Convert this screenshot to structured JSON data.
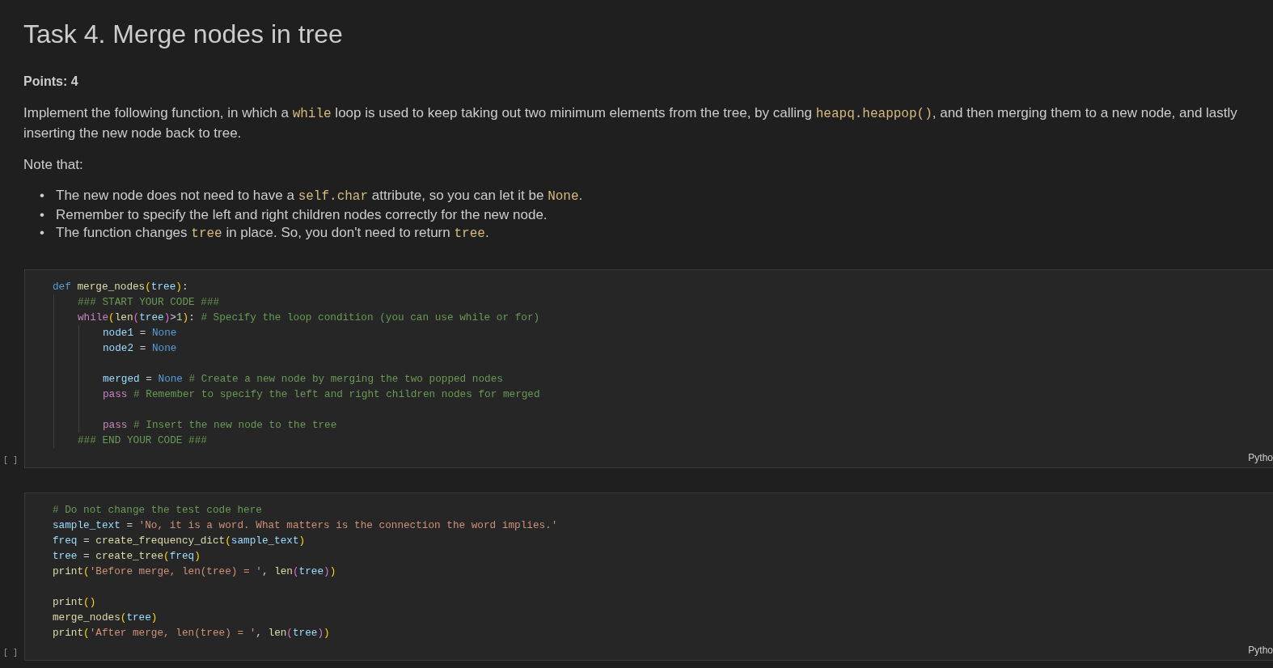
{
  "title": "Task 4. Merge nodes in tree",
  "points": "Points: 4",
  "intro": [
    {
      "kind": "text",
      "text": "Implement the following function, in which a "
    },
    {
      "kind": "code",
      "text": "while"
    },
    {
      "kind": "text",
      "text": " loop is used to keep taking out two minimum elements from the tree, by calling "
    },
    {
      "kind": "code",
      "text": "heapq.heappop()"
    },
    {
      "kind": "text",
      "text": ", and then merging them to a new node, and lastly inserting the new node back to tree."
    }
  ],
  "note": "Note that:",
  "bullets": [
    {
      "marker": "•",
      "segments": [
        {
          "kind": "text",
          "text": "The new node does not need to have a "
        },
        {
          "kind": "code",
          "text": "self.char"
        },
        {
          "kind": "text",
          "text": " attribute, so you can let it be "
        },
        {
          "kind": "code",
          "text": "None"
        },
        {
          "kind": "text",
          "text": "."
        }
      ]
    },
    {
      "marker": "•",
      "segments": [
        {
          "kind": "text",
          "text": "Remember to specify the left and right children nodes correctly for the new node."
        }
      ]
    },
    {
      "marker": "•",
      "segments": [
        {
          "kind": "text",
          "text": "The function changes "
        },
        {
          "kind": "code",
          "text": "tree"
        },
        {
          "kind": "text",
          "text": " in place. So, you don't need to return "
        },
        {
          "kind": "code",
          "text": "tree"
        },
        {
          "kind": "text",
          "text": "."
        }
      ]
    }
  ],
  "cells": [
    {
      "execution_count": "[ ]",
      "language": "Pytho",
      "lines": [
        {
          "kind": "code",
          "tokens": [
            {
              "kind": "kw",
              "text": "def "
            },
            {
              "kind": "fn",
              "text": "merge_nodes"
            },
            {
              "kind": "p1",
              "text": "("
            },
            {
              "kind": "var",
              "text": "tree"
            },
            {
              "kind": "p1",
              "text": ")"
            },
            {
              "kind": "op",
              "text": ":"
            }
          ],
          "children": [
            {
              "kind": "code",
              "tokens": [
                {
                  "kind": "comment",
                  "text": "### START YOUR CODE ###"
                }
              ]
            },
            {
              "kind": "code",
              "tokens": [
                {
                  "kind": "ctrl",
                  "text": "while"
                },
                {
                  "kind": "p1",
                  "text": "("
                },
                {
                  "kind": "fn",
                  "text": "len"
                },
                {
                  "kind": "p2",
                  "text": "("
                },
                {
                  "kind": "var",
                  "text": "tree"
                },
                {
                  "kind": "p2",
                  "text": ")"
                },
                {
                  "kind": "op",
                  "text": ">"
                },
                {
                  "kind": "num",
                  "text": "1"
                },
                {
                  "kind": "p1",
                  "text": ")"
                },
                {
                  "kind": "op",
                  "text": ": "
                },
                {
                  "kind": "comment",
                  "text": "# Specify the loop condition (you can use while or for)"
                }
              ],
              "children": [
                {
                  "kind": "code",
                  "tokens": [
                    {
                      "kind": "var",
                      "text": "node1"
                    },
                    {
                      "kind": "op",
                      "text": " = "
                    },
                    {
                      "kind": "kw",
                      "text": "None"
                    }
                  ]
                },
                {
                  "kind": "code",
                  "tokens": [
                    {
                      "kind": "var",
                      "text": "node2"
                    },
                    {
                      "kind": "op",
                      "text": " = "
                    },
                    {
                      "kind": "kw",
                      "text": "None"
                    }
                  ]
                },
                {
                  "kind": "blank"
                },
                {
                  "kind": "code",
                  "tokens": [
                    {
                      "kind": "var",
                      "text": "merged"
                    },
                    {
                      "kind": "op",
                      "text": " = "
                    },
                    {
                      "kind": "kw",
                      "text": "None"
                    },
                    {
                      "kind": "comment",
                      "text": " # Create a new node by merging the two popped nodes"
                    }
                  ]
                },
                {
                  "kind": "code",
                  "tokens": [
                    {
                      "kind": "ctrl",
                      "text": "pass"
                    },
                    {
                      "kind": "comment",
                      "text": " # Remember to specify the left and right children nodes for merged"
                    }
                  ]
                },
                {
                  "kind": "blank"
                },
                {
                  "kind": "code",
                  "tokens": [
                    {
                      "kind": "ctrl",
                      "text": "pass"
                    },
                    {
                      "kind": "comment",
                      "text": " # Insert the new node to the tree"
                    }
                  ]
                }
              ]
            },
            {
              "kind": "code",
              "tokens": [
                {
                  "kind": "comment",
                  "text": "### END YOUR CODE ###"
                }
              ]
            }
          ]
        }
      ]
    },
    {
      "execution_count": "[ ]",
      "language": "Pytho",
      "lines": [
        {
          "kind": "code",
          "tokens": [
            {
              "kind": "comment",
              "text": "# Do not change the test code here"
            }
          ]
        },
        {
          "kind": "code",
          "tokens": [
            {
              "kind": "var",
              "text": "sample_text"
            },
            {
              "kind": "op",
              "text": " = "
            },
            {
              "kind": "str",
              "text": "'No, it is a word. What matters is the connection the word implies.'"
            }
          ]
        },
        {
          "kind": "code",
          "tokens": [
            {
              "kind": "var",
              "text": "freq"
            },
            {
              "kind": "op",
              "text": " = "
            },
            {
              "kind": "fn",
              "text": "create_frequency_dict"
            },
            {
              "kind": "p1",
              "text": "("
            },
            {
              "kind": "var",
              "text": "sample_text"
            },
            {
              "kind": "p1",
              "text": ")"
            }
          ]
        },
        {
          "kind": "code",
          "tokens": [
            {
              "kind": "var",
              "text": "tree"
            },
            {
              "kind": "op",
              "text": " = "
            },
            {
              "kind": "fn",
              "text": "create_tree"
            },
            {
              "kind": "p1",
              "text": "("
            },
            {
              "kind": "var",
              "text": "freq"
            },
            {
              "kind": "p1",
              "text": ")"
            }
          ]
        },
        {
          "kind": "code",
          "tokens": [
            {
              "kind": "fn",
              "text": "print"
            },
            {
              "kind": "p1",
              "text": "("
            },
            {
              "kind": "str",
              "text": "'Before merge, len(tree) = '"
            },
            {
              "kind": "op",
              "text": ", "
            },
            {
              "kind": "fn",
              "text": "len"
            },
            {
              "kind": "p2",
              "text": "("
            },
            {
              "kind": "var",
              "text": "tree"
            },
            {
              "kind": "p2",
              "text": ")"
            },
            {
              "kind": "p1",
              "text": ")"
            }
          ]
        },
        {
          "kind": "blank"
        },
        {
          "kind": "code",
          "tokens": [
            {
              "kind": "fn",
              "text": "print"
            },
            {
              "kind": "p1",
              "text": "()"
            }
          ]
        },
        {
          "kind": "code",
          "tokens": [
            {
              "kind": "fn",
              "text": "merge_nodes"
            },
            {
              "kind": "p1",
              "text": "("
            },
            {
              "kind": "var",
              "text": "tree"
            },
            {
              "kind": "p1",
              "text": ")"
            }
          ]
        },
        {
          "kind": "code",
          "tokens": [
            {
              "kind": "fn",
              "text": "print"
            },
            {
              "kind": "p1",
              "text": "("
            },
            {
              "kind": "str",
              "text": "'After merge, len(tree) = '"
            },
            {
              "kind": "op",
              "text": ", "
            },
            {
              "kind": "fn",
              "text": "len"
            },
            {
              "kind": "p2",
              "text": "("
            },
            {
              "kind": "var",
              "text": "tree"
            },
            {
              "kind": "p2",
              "text": ")"
            },
            {
              "kind": "p1",
              "text": ")"
            }
          ]
        }
      ]
    }
  ]
}
